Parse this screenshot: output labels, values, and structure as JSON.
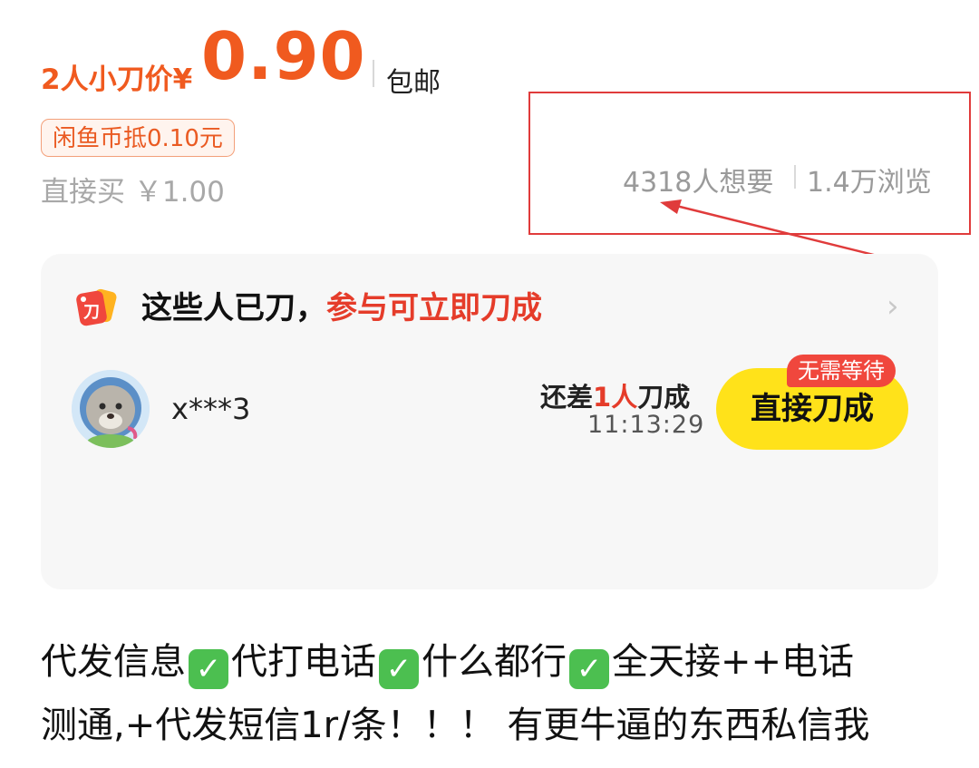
{
  "price": {
    "label": "2人小刀价¥",
    "amount": "0.90",
    "shipping": "包邮",
    "coin_badge": "闲鱼币抵0.10元",
    "direct_buy": "直接买 ￥1.00"
  },
  "stats": {
    "want": "4318人想要",
    "views": "1.4万浏览"
  },
  "annotation": {
    "color": "#e03b3b"
  },
  "bargain_card": {
    "icon": "knife-tag-icon",
    "icon_char": "刀",
    "title_black": "这些人已刀，",
    "title_red": "参与可立即刀成",
    "entry": {
      "username": "x***3",
      "need_prefix": "还差",
      "need_count": "1人",
      "need_suffix": "刀成",
      "timer": "11:13:29",
      "button_label": "直接刀成",
      "badge": "无需等待"
    }
  },
  "description": {
    "line1": [
      "代发信息",
      "代打电话",
      "什么都行",
      "全天接++电话"
    ],
    "line2": "测通,+代发短信1r/条！！！ 有更牛逼的东西私信我",
    "check_icon": "check-mark-icon"
  },
  "colors": {
    "accent_orange": "#f05a1f",
    "highlight_red": "#e53c2a",
    "button_yellow": "#ffe21a",
    "badge_red": "#f0473d",
    "check_green": "#4cbf50"
  }
}
